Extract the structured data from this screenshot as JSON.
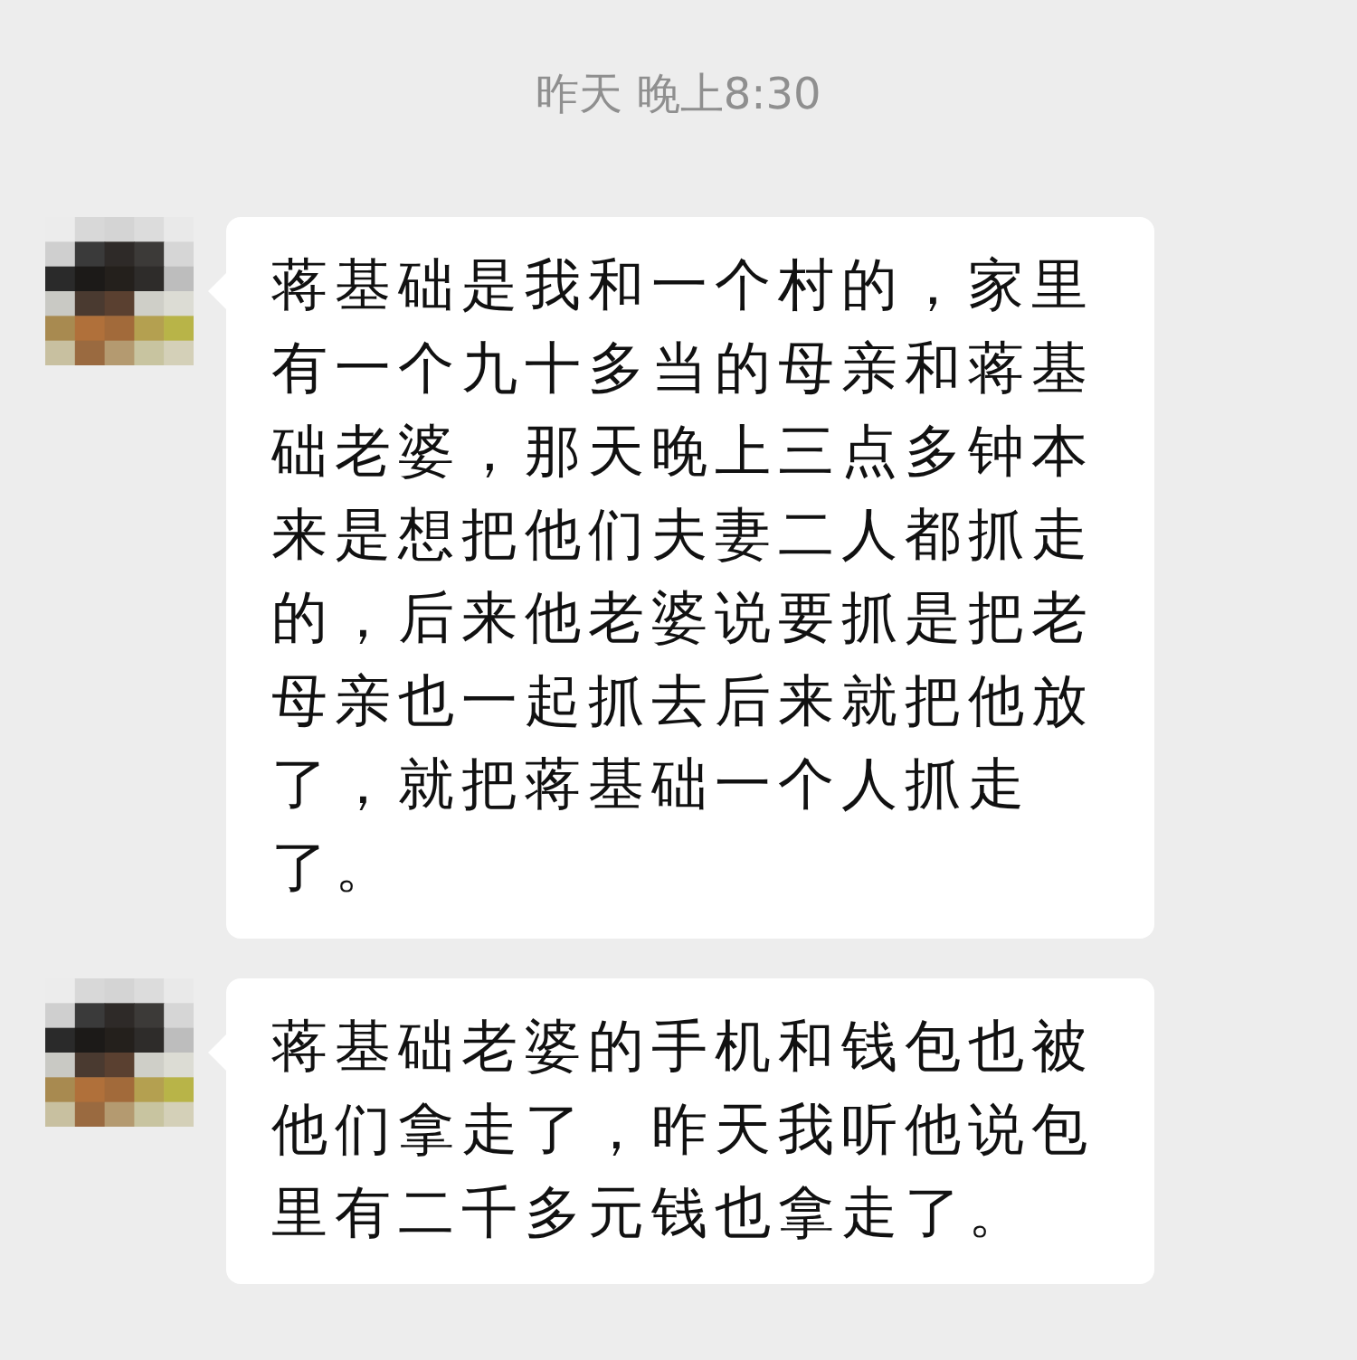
{
  "timestamp": "昨天 晚上8:30",
  "messages": [
    {
      "text": "蒋基础是我和一个村的，家里有一个九十多当的母亲和蒋基础老婆，那天晚上三点多钟本来是想把他们夫妻二人都抓走的，后来他老婆说要抓是把老母亲也一起抓去后来就把他放了，就把蒋基础一个人抓走了。"
    },
    {
      "text": "蒋基础老婆的手机和钱包也被他们拿走了，昨天我听他说包里有二千多元钱也拿走了。"
    }
  ]
}
